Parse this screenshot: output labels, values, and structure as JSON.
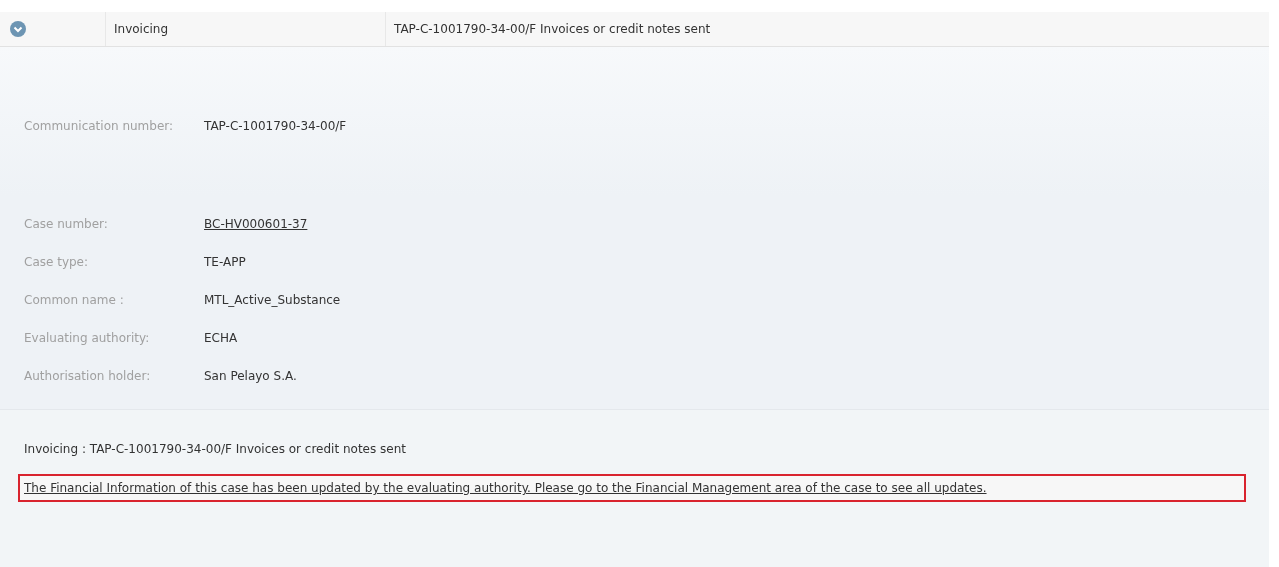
{
  "row": {
    "expanded": true,
    "type": "Invoicing",
    "description": "TAP-C-1001790-34-00/F Invoices or credit notes sent"
  },
  "communication": {
    "label": "Communication number:",
    "value": "TAP-C-1001790-34-00/F"
  },
  "fields": [
    {
      "label": "Case number:",
      "value": "BC-HV000601-37",
      "kind": "link"
    },
    {
      "label": "Case type:",
      "value": "TE-APP",
      "kind": "text"
    },
    {
      "label": "Common name :",
      "value": "MTL_Active_Substance",
      "kind": "text"
    },
    {
      "label": "Evaluating authority:",
      "value": "ECHA",
      "kind": "text"
    },
    {
      "label": "Authorisation holder:",
      "value": "San Pelayo S.A.",
      "kind": "text"
    }
  ],
  "summary": "Invoicing : TAP-C-1001790-34-00/F Invoices or credit notes sent",
  "notice": "The Financial Information of this case has been updated by the evaluating authority. Please go to the Financial Management area of the case to see all updates."
}
